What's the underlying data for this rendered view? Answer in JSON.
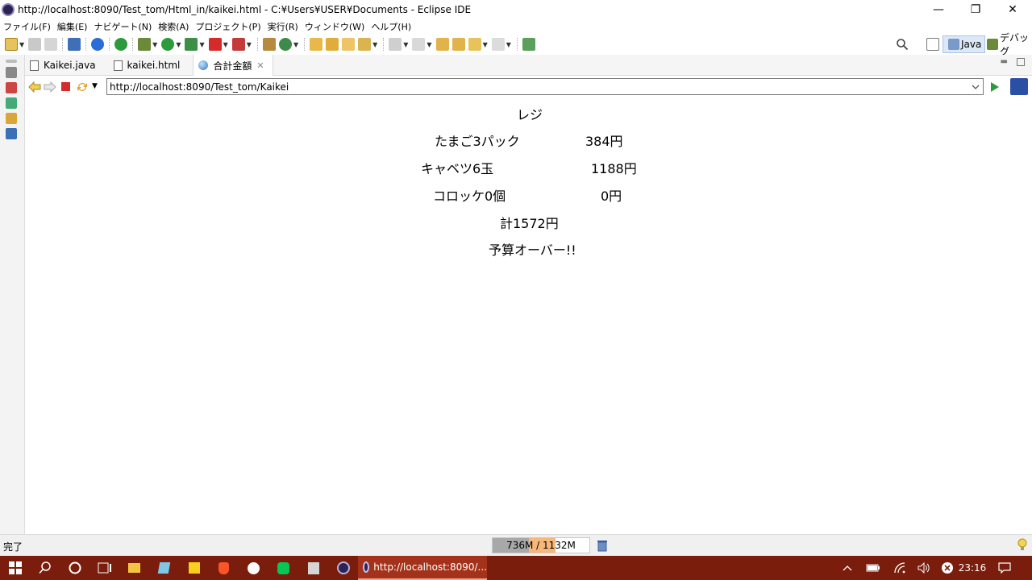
{
  "window": {
    "title": "http://localhost:8090/Test_tom/Html_in/kaikei.html - C:¥Users¥USER¥Documents - Eclipse IDE",
    "minimize": "—",
    "restore": "❐",
    "close": "✕"
  },
  "menu": [
    "ファイル(F)",
    "編集(E)",
    "ナビゲート(N)",
    "検索(A)",
    "プロジェクト(P)",
    "実行(R)",
    "ウィンドウ(W)",
    "ヘルプ(H)"
  ],
  "perspectives": {
    "java": "Java",
    "debug": "デバッグ"
  },
  "tabs": [
    {
      "label": "Kaikei.java",
      "icon": "java-file-icon"
    },
    {
      "label": "kaikei.html",
      "icon": "html-file-icon"
    },
    {
      "label": "合計金額",
      "icon": "globe-icon",
      "active": true,
      "close": "✕"
    }
  ],
  "browser": {
    "url": "http://localhost:8090/Test_tom/Kaikei"
  },
  "page": {
    "heading": "レジ",
    "items": [
      {
        "name": "たまご3パック",
        "price": "384円"
      },
      {
        "name": "キャベツ6玉",
        "price": "1188円"
      },
      {
        "name": "コロッケ0個",
        "price": "0円"
      }
    ],
    "total": "計1572円",
    "message": "予算オーバー!!"
  },
  "status": {
    "text": "完了",
    "heap_label": "736M / 1132M",
    "heap_used_fraction": 0.65,
    "heap_committed_fraction": 0.6
  },
  "taskbar": {
    "active_app_label": "http://localhost:8090/...",
    "clock": "23:16"
  },
  "colors": {
    "taskbar": "#7a1d0c",
    "heap_used": "#a8a8a8",
    "heap_fill": "#f7b77b"
  }
}
